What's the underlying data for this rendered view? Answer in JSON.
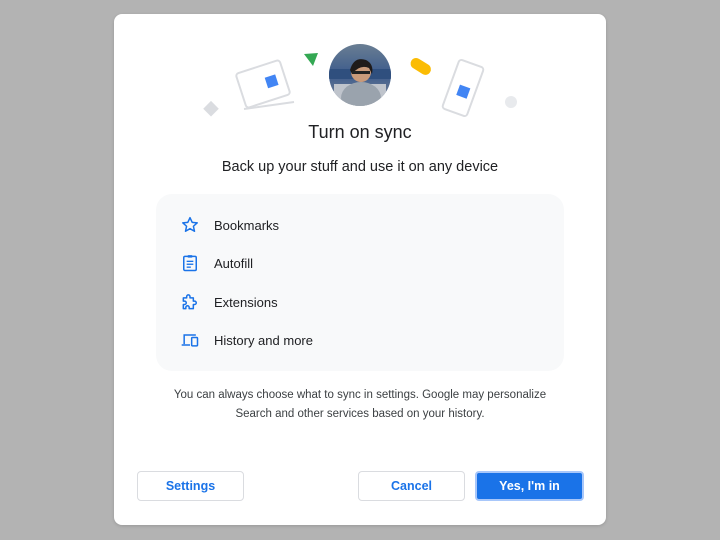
{
  "dialog": {
    "title": "Turn on sync",
    "subtitle": "Back up your stuff and use it on any device",
    "features": [
      {
        "label": "Bookmarks",
        "icon": "star-icon"
      },
      {
        "label": "Autofill",
        "icon": "clipboard-icon"
      },
      {
        "label": "Extensions",
        "icon": "puzzle-icon"
      },
      {
        "label": "History and more",
        "icon": "devices-icon"
      }
    ],
    "footnote_line1": "You can always choose what to sync in settings. Google may personalize",
    "footnote_line2": "Search and other services based on your history.",
    "buttons": {
      "settings": "Settings",
      "cancel": "Cancel",
      "confirm": "Yes, I'm in"
    }
  },
  "colors": {
    "accent": "#1a73e8",
    "overlay": "#b3b3b3",
    "panel": "#f8f9fa",
    "green": "#34a853",
    "yellow": "#fbbc04"
  }
}
